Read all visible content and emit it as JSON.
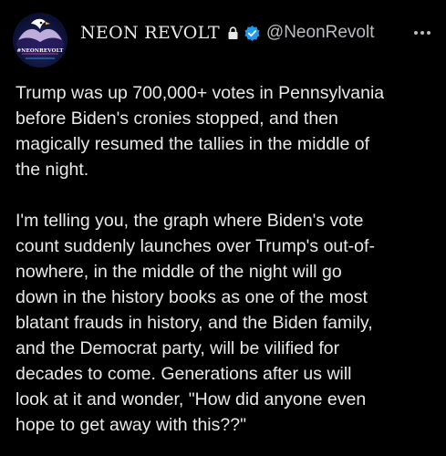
{
  "tweet": {
    "author": {
      "display_name": "NEON REVOLT",
      "handle": "@NeonRevolt",
      "avatar_text": "#NEONREVOLT",
      "avatar_icon": "eagle-avatar-icon",
      "protected_icon": "lock-icon",
      "verified_icon": "verified-badge-icon"
    },
    "more_icon": "more-options-icon",
    "paragraphs": [
      "Trump was up 700,000+ votes in Pennsylvania\nbefore Biden's cronies stopped, and then\nmagically resumed the tallies in the middle of\nthe night.",
      "I'm telling you, the graph where Biden's vote\ncount suddenly launches over Trump's out-of-\nnowhere, in the middle of the night will go\ndown in the history books as one of the most\nblatant frauds in history, and the Biden family,\nand the Democrat party, will be vilified for\ndecades to come. Generations after us will\nlook at it and wonder, \"How did anyone even\nhope to get away with this??\""
    ]
  },
  "colors": {
    "background": "#000000",
    "text": "#e7e9ea",
    "secondary_text": "#b9bcc0",
    "verified": "#1d9bf0"
  }
}
